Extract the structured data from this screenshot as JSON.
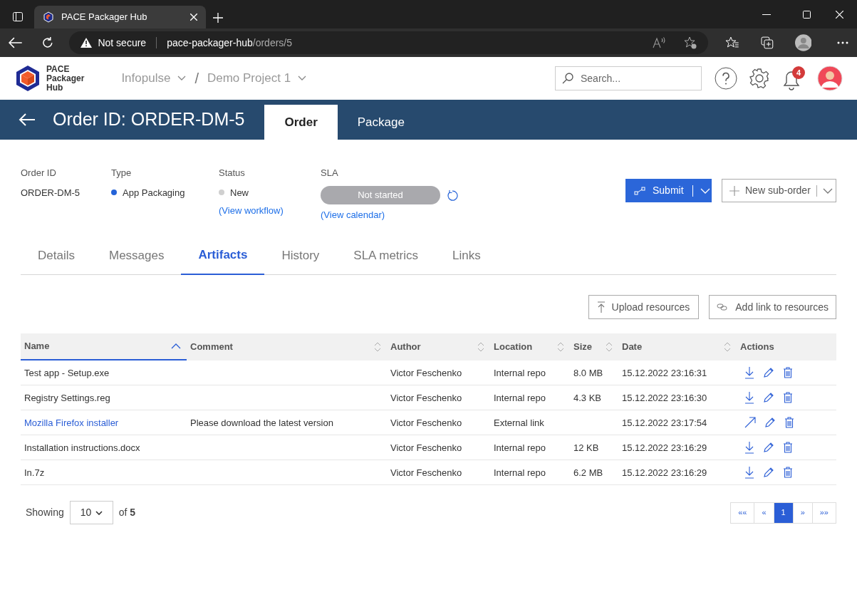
{
  "browser": {
    "tab_title": "PACE Packager Hub",
    "security": "Not secure",
    "host": "pace-packager-hub",
    "path": "/orders/5"
  },
  "header": {
    "logo_lines": [
      "PACE",
      "Packager",
      "Hub"
    ],
    "breadcrumb": [
      "Infopulse",
      "Demo Project 1"
    ],
    "separator": "/",
    "search": {
      "placeholder": "Search..."
    },
    "notifications": "4"
  },
  "order_bar": {
    "title": "Order ID: ORDER-DM-5",
    "tabs": [
      {
        "label": "Order",
        "selected": true
      },
      {
        "label": "Package",
        "selected": false
      }
    ]
  },
  "summary": {
    "order_id": {
      "label": "Order ID",
      "value": "ORDER-DM-5"
    },
    "type": {
      "label": "Type",
      "value": "App Packaging",
      "color": "#2563d8"
    },
    "status": {
      "label": "Status",
      "value": "New",
      "color": "#d0d0d0",
      "link": "(View workflow)"
    },
    "sla": {
      "label": "SLA",
      "value": "Not started",
      "link": "(View calendar)"
    }
  },
  "actions": {
    "submit": "Submit",
    "new_suborder": "New sub-order"
  },
  "subtabs": [
    {
      "label": "Details",
      "selected": false
    },
    {
      "label": "Messages",
      "selected": false
    },
    {
      "label": "Artifacts",
      "selected": true
    },
    {
      "label": "History",
      "selected": false
    },
    {
      "label": "SLA metrics",
      "selected": false
    },
    {
      "label": "Links",
      "selected": false
    }
  ],
  "resource_buttons": {
    "upload": "Upload resources",
    "add_link": "Add link to resources"
  },
  "table": {
    "columns": [
      {
        "label": "Name",
        "sortable": true,
        "sorted": true
      },
      {
        "label": "Comment",
        "sortable": true,
        "sorted": false
      },
      {
        "label": "Author",
        "sortable": true,
        "sorted": false
      },
      {
        "label": "Location",
        "sortable": true,
        "sorted": false
      },
      {
        "label": "Size",
        "sortable": true,
        "sorted": false
      },
      {
        "label": "Date",
        "sortable": true,
        "sorted": false
      },
      {
        "label": "Actions",
        "sortable": false
      }
    ],
    "rows": [
      {
        "name": "Test app - Setup.exe",
        "link": false,
        "author": "Victor Feschenko",
        "location": "Internal repo",
        "size": "8.0 MB",
        "date": "15.12.2022 23:16:31",
        "kind": "file"
      },
      {
        "name": "Registry Settings.reg",
        "link": false,
        "author": "Victor Feschenko",
        "location": "Internal repo",
        "size": "4.3 KB",
        "date": "15.12.2022 23:16:30",
        "kind": "file"
      },
      {
        "name": "Mozilla Firefox installer",
        "link": true,
        "comment": "Please download the latest version",
        "author": "Victor Feschenko",
        "location": "External link",
        "date": "15.12.2022 23:17:54",
        "kind": "external"
      },
      {
        "name": "Installation instructions.docx",
        "link": false,
        "author": "Victor Feschenko",
        "location": "Internal repo",
        "size": "12 KB",
        "date": "15.12.2022 23:16:29",
        "kind": "file"
      },
      {
        "name": "In.7z",
        "link": false,
        "author": "Victor Feschenko",
        "location": "Internal repo",
        "size": "6.2 MB",
        "date": "15.12.2022 23:16:29",
        "kind": "file"
      }
    ]
  },
  "pagination": {
    "showing": "Showing",
    "page_size": "10",
    "total": "of **5**",
    "pages": [
      {
        "label": "««",
        "selected": false
      },
      {
        "label": "«",
        "selected": false
      },
      {
        "label": "1",
        "selected": true
      },
      {
        "label": "»",
        "selected": false
      },
      {
        "label": "»»",
        "selected": false
      }
    ]
  }
}
